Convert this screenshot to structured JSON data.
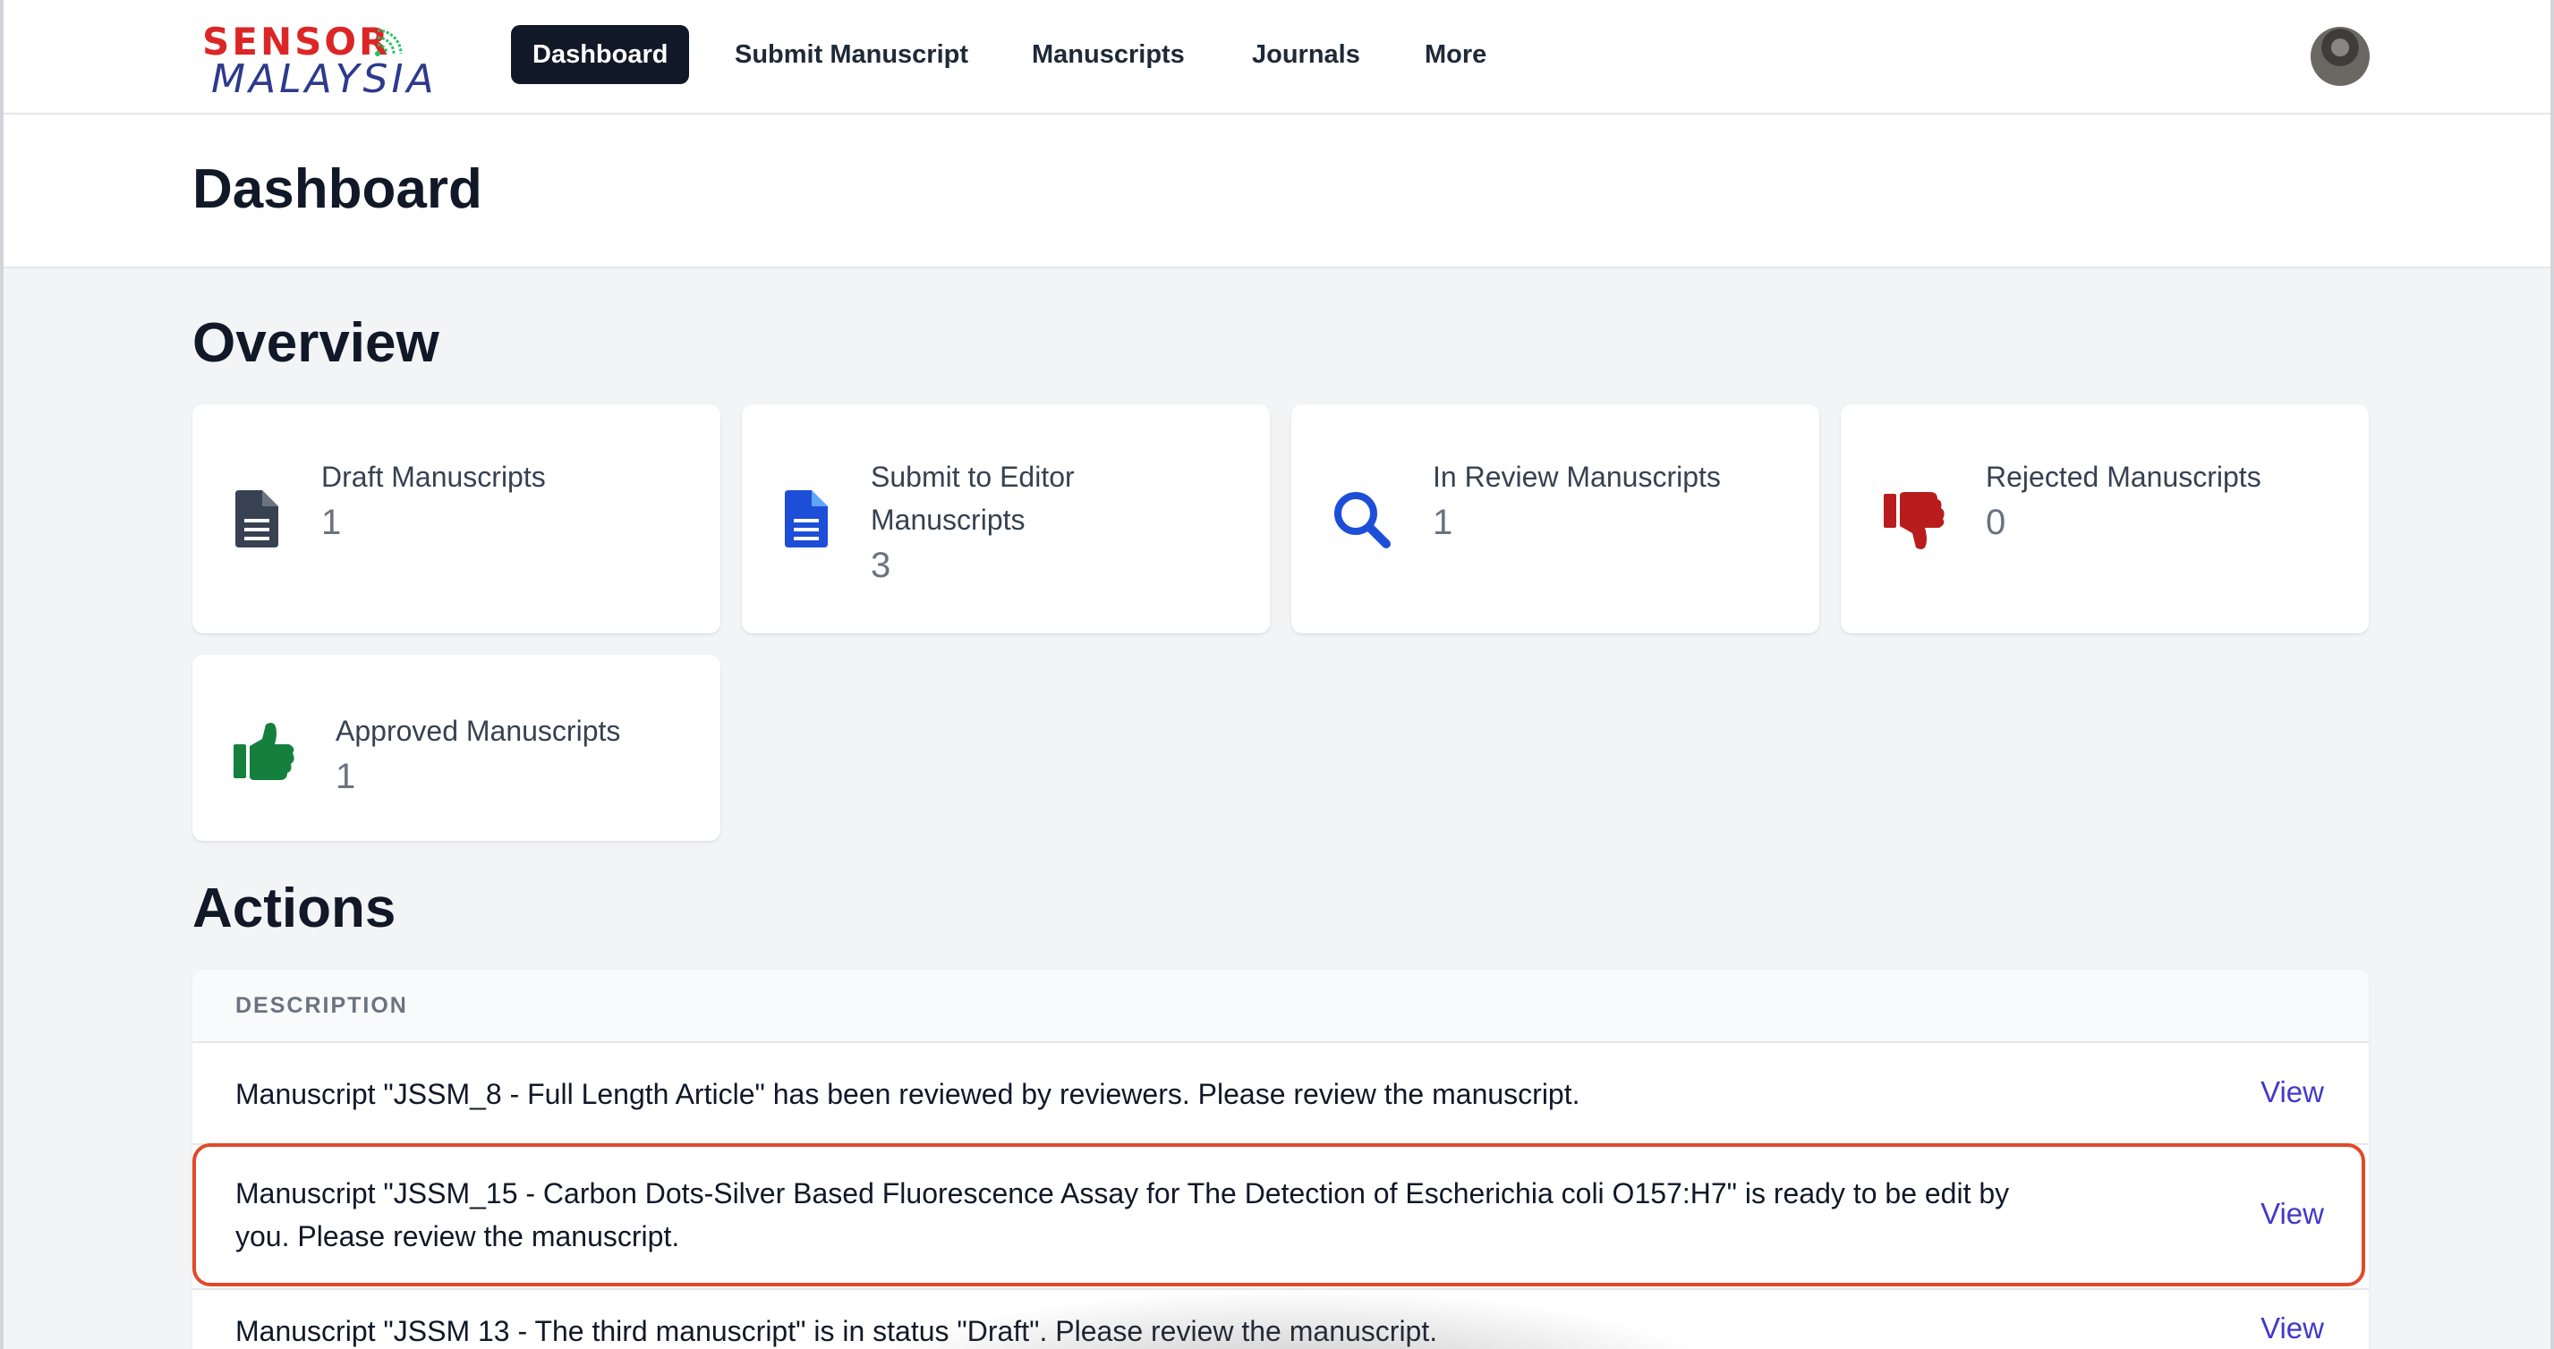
{
  "brand": {
    "logo_line1": "SENSOR",
    "logo_line2": "MALAYSIA",
    "colors": {
      "red": "#dc2626",
      "blue": "#2d3a8c",
      "green": "#22c55e"
    }
  },
  "nav": {
    "items": [
      {
        "label": "Dashboard",
        "active": true
      },
      {
        "label": "Submit Manuscript"
      },
      {
        "label": "Manuscripts"
      },
      {
        "label": "Journals"
      },
      {
        "label": "More"
      }
    ],
    "avatar_icon": "user-avatar"
  },
  "page": {
    "title": "Dashboard"
  },
  "overview": {
    "title": "Overview",
    "cards": [
      {
        "label": "Draft Manuscripts",
        "value": "1",
        "icon": "document-icon",
        "color": "#374151"
      },
      {
        "label_line1": "Submit to Editor",
        "label_line2": "Manuscripts",
        "value": "3",
        "icon": "document-blue-icon",
        "color": "#1d4ed8"
      },
      {
        "label": "In Review Manuscripts",
        "value": "1",
        "icon": "search-icon",
        "color": "#1d4ed8"
      },
      {
        "label": "Rejected Manuscripts",
        "value": "0",
        "icon": "thumbs-down-icon",
        "color": "#b91c1c"
      },
      {
        "label": "Approved Manuscripts",
        "value": "1",
        "icon": "thumbs-up-icon",
        "color": "#15803d"
      }
    ]
  },
  "actions": {
    "title": "Actions",
    "column_header": "DESCRIPTION",
    "rows": [
      {
        "description": "Manuscript \"JSSM_8 - Full Length Article\" has been reviewed by reviewers. Please review the manuscript.",
        "link": "View"
      },
      {
        "description_line1": "Manuscript \"JSSM_15 - Carbon Dots-Silver Based Fluorescence Assay for The Detection of Escherichia coli O157:H7\" is ready to be edit by",
        "description_line2": "you. Please review the manuscript.",
        "link": "View",
        "highlighted": true
      },
      {
        "description": "Manuscript \"JSSM 13 - The third manuscript\" is in status \"Draft\". Please review the manuscript.",
        "link": "View"
      }
    ],
    "link_color": "#4338ca",
    "highlight_color": "#e0492a"
  }
}
